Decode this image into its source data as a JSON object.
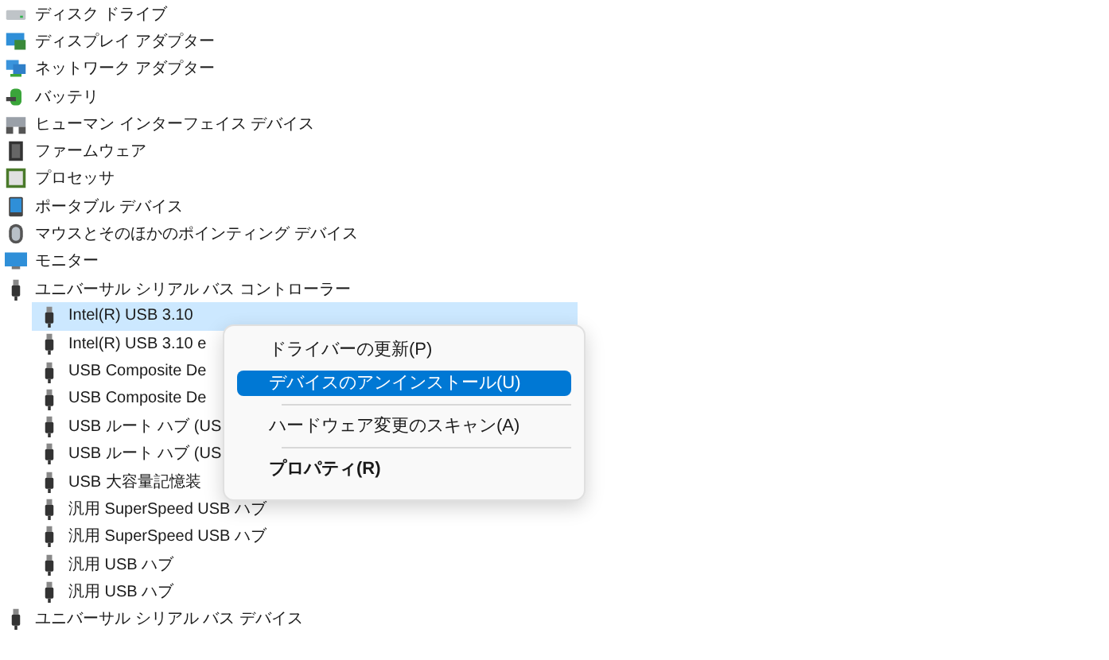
{
  "tree": [
    {
      "label": "ディスク ドライブ",
      "kind": "disk"
    },
    {
      "label": "ディスプレイ アダプター",
      "kind": "display"
    },
    {
      "label": "ネットワーク アダプター",
      "kind": "network"
    },
    {
      "label": "バッテリ",
      "kind": "battery"
    },
    {
      "label": "ヒューマン インターフェイス デバイス",
      "kind": "hid"
    },
    {
      "label": "ファームウェア",
      "kind": "chip"
    },
    {
      "label": "プロセッサ",
      "kind": "cpu"
    },
    {
      "label": "ポータブル デバイス",
      "kind": "portable"
    },
    {
      "label": "マウスとそのほかのポインティング デバイス",
      "kind": "mouse"
    },
    {
      "label": "モニター",
      "kind": "monitor"
    },
    {
      "label": "ユニバーサル シリアル バス コントローラー",
      "kind": "usb",
      "children": [
        {
          "label": "Intel(R) USB 3.10",
          "selected": true
        },
        {
          "label": "Intel(R) USB 3.10 e",
          "selected": false
        },
        {
          "label": "USB Composite De",
          "selected": false
        },
        {
          "label": "USB Composite De",
          "selected": false
        },
        {
          "label": "USB ルート ハブ (US",
          "selected": false
        },
        {
          "label": "USB ルート ハブ (US",
          "selected": false
        },
        {
          "label": "USB 大容量記憶装",
          "selected": false
        },
        {
          "label": "汎用 SuperSpeed USB ハブ",
          "selected": false
        },
        {
          "label": "汎用 SuperSpeed USB ハブ",
          "selected": false
        },
        {
          "label": "汎用 USB ハブ",
          "selected": false
        },
        {
          "label": "汎用 USB ハブ",
          "selected": false
        }
      ]
    },
    {
      "label": "ユニバーサル シリアル バス デバイス",
      "kind": "usb"
    }
  ],
  "context_menu": [
    {
      "kind": "item",
      "label": "ドライバーの更新(P)",
      "selected": false,
      "default": false
    },
    {
      "kind": "item",
      "label": "デバイスのアンインストール(U)",
      "selected": true,
      "default": false
    },
    {
      "kind": "separator"
    },
    {
      "kind": "item",
      "label": "ハードウェア変更のスキャン(A)",
      "selected": false,
      "default": false
    },
    {
      "kind": "separator"
    },
    {
      "kind": "item",
      "label": "プロパティ(R)",
      "selected": false,
      "default": true
    }
  ]
}
